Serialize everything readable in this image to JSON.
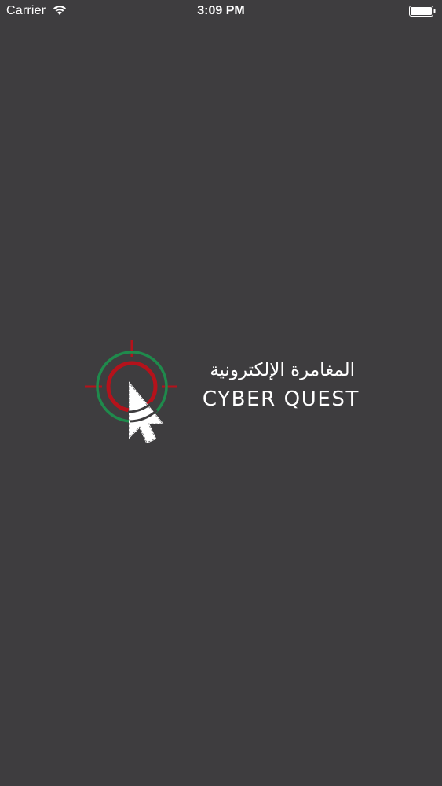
{
  "status_bar": {
    "carrier": "Carrier",
    "time": "3:09 PM",
    "wifi_icon": "wifi-icon",
    "battery_icon": "battery-icon"
  },
  "logo": {
    "arabic_title": "المغامرة الإلكترونية",
    "english_title": "CYBER QUEST",
    "mark_icon": "crosshair-cursor-icon",
    "colors": {
      "background": "#3e3d3f",
      "ring_outer": "#1f8a4c",
      "ring_inner": "#b5121b",
      "cursor": "#ffffff"
    }
  }
}
